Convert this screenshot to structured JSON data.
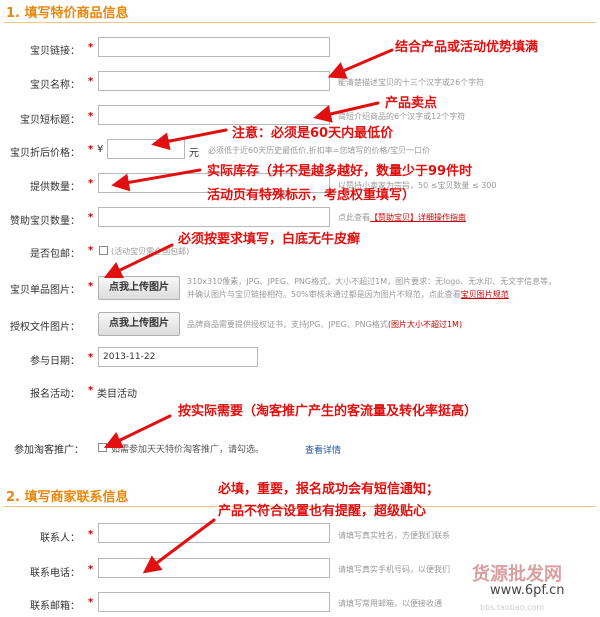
{
  "section1": {
    "title": "1. 填写特价商品信息"
  },
  "section2": {
    "title": "2. 填写商家联系信息"
  },
  "fields": {
    "link": {
      "label": "宝贝链接："
    },
    "name": {
      "label": "宝贝名称：",
      "hint": "能清楚描述宝贝的十三个汉字或26个字符"
    },
    "short": {
      "label": "宝贝短标题：",
      "hint": "简短介绍商品的6个汉字或12个字符"
    },
    "price": {
      "label": "宝贝折后价格：",
      "currency": "¥",
      "unit": "元",
      "hint": "必须低于近60天历史最低价,折扣率=您填写的价格/宝贝一口价"
    },
    "qty": {
      "label": "提供数量：",
      "hint": "以赞持小卖家为宗旨，50 ≤宝贝数量 ≤ 300"
    },
    "sponsor": {
      "label": "赞助宝贝数量：",
      "hint_prefix": "点此查看",
      "hint_link": "【赞助宝贝】详细操作指南"
    },
    "shipping": {
      "label": "是否包邮：",
      "checkbox_text": "(活动宝贝需全国包邮)"
    },
    "image": {
      "label": "宝贝单品图片：",
      "button": "点我上传图片",
      "hint1": "310x310像素，JPG、JPEG、PNG格式，大小不超过1M，图片要求：无logo、无水印、无文字信息等，",
      "hint2_prefix": "并确认图片与宝贝链接相符。50%审核未通过都是因为图片不规范，点此查看",
      "hint2_link": "宝贝图片规范"
    },
    "auth": {
      "label": "授权文件图片：",
      "button": "点我上传图片",
      "hint_prefix": "品牌商品需要提供授权证书，支持JPG、JPEG、PNG格式",
      "hint_highlight": "(图片大小不超过1M)"
    },
    "date": {
      "label": "参与日期：",
      "value": "2013-11-22"
    },
    "activity": {
      "label": "报名活动：",
      "value": "类目活动"
    },
    "taoke": {
      "label": "参加淘客推广：",
      "checkbox_text": "如需参加天天特价淘客推广，请勾选。",
      "link": "查看详情"
    },
    "contact": {
      "label": "联系人：",
      "hint": "请填写真实姓名，方便我们联系"
    },
    "phone": {
      "label": "联系电话：",
      "hint": "请填写真实手机号码，以便我们"
    },
    "email": {
      "label": "联系邮箱：",
      "hint": "请填写常用邮箱，以便接收通"
    }
  },
  "required_mark": "*",
  "annotations": {
    "a1": "结合产品或活动优势填满",
    "a2": "产品卖点",
    "a3": "注意：必须是60天内最低价",
    "a4": "实际库存（并不是越多越好，数量少于99件时",
    "a5": "活动页有特殊标示，考虑权重填写）",
    "a6": "必须按要求填写，白底无牛皮癣",
    "a7": "按实际需要（淘客推广产生的客流量及转化率挺高）",
    "a8": "必填，重要，报名成功会有短信通知；",
    "a9": "产品不符合设置也有提醒，超级贴心"
  },
  "watermark": {
    "brand": "货源批发网",
    "url": "www.6pf.cn",
    "sub": "bbs.taobao.com"
  },
  "colors": {
    "annotation": "#e01010",
    "section_title": "#e8870c",
    "required": "#d40000"
  }
}
